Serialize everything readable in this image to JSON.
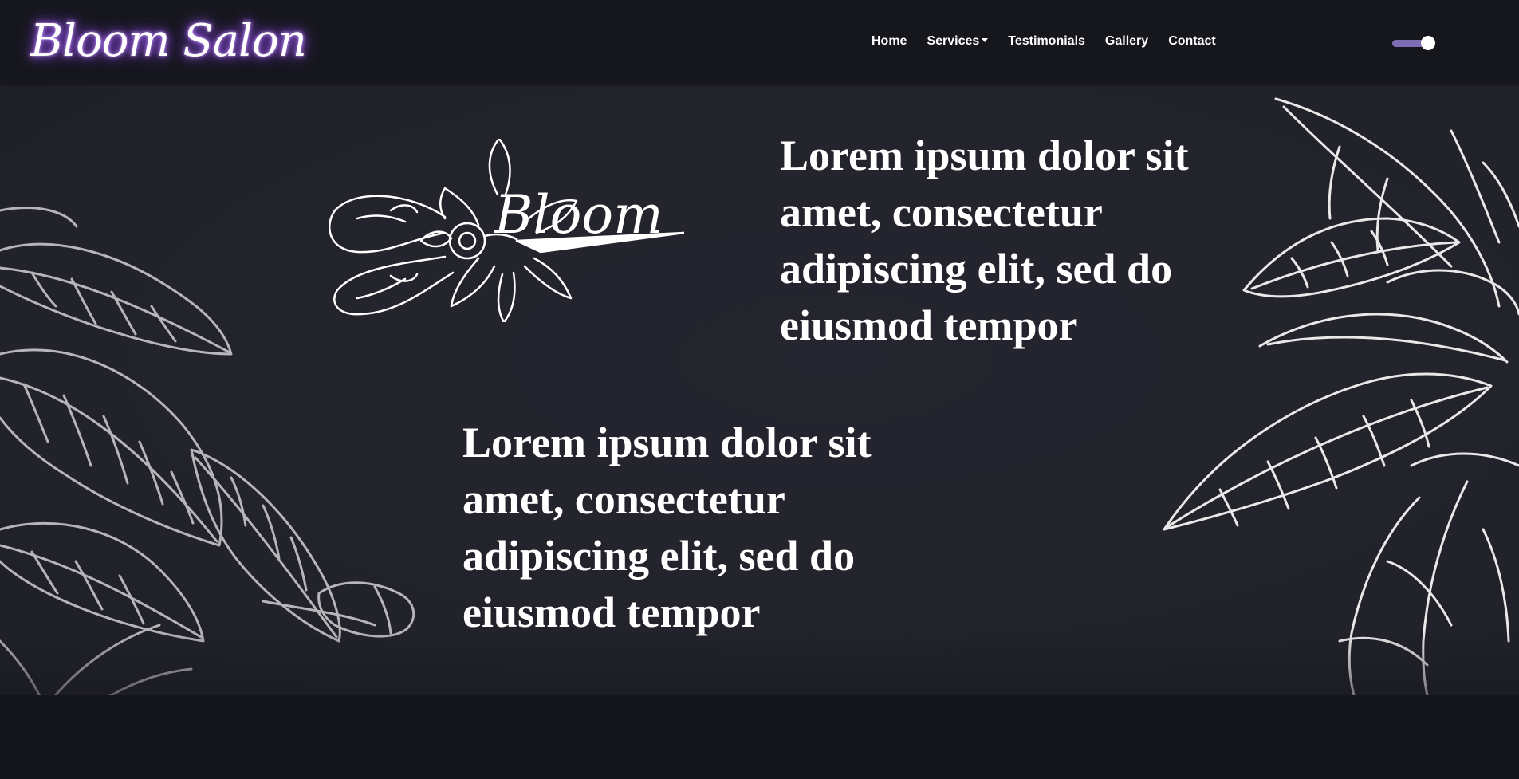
{
  "navbar": {
    "brand": "Bloom Salon",
    "links": [
      {
        "label": "Home"
      },
      {
        "label": "Services",
        "has_dropdown": true
      },
      {
        "label": "Testimonials"
      },
      {
        "label": "Gallery"
      },
      {
        "label": "Contact"
      }
    ],
    "theme_toggle": {
      "state": "on",
      "track_color": "#7e6db4"
    }
  },
  "hero": {
    "logo_text": "Bloom",
    "text_1": "Lorem ipsum dolor sit amet, consectetur adipiscing elit, sed do eiusmod tempor",
    "text_2": "Lorem ipsum dolor sit amet, consectetur adipiscing elit, sed do eiusmod tempor",
    "decor": [
      "leaf-outline-left",
      "leaf-outline-right",
      "scissors-flower-emblem"
    ]
  },
  "colors": {
    "background": "#23232c",
    "navbar": "#16171d",
    "brand_glow": "#a25eff",
    "text": "#ffffff"
  }
}
